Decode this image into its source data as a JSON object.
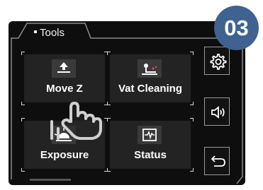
{
  "header": {
    "tab_title": "Tools"
  },
  "step_badge": {
    "text": "03",
    "color": "#3f6290"
  },
  "tiles": [
    {
      "label": "Move Z",
      "icon": "move-z-icon"
    },
    {
      "label": "Vat Cleaning",
      "icon": "vat-cleaning-icon"
    },
    {
      "label": "Exposure",
      "icon": "exposure-icon"
    },
    {
      "label": "Status",
      "icon": "status-icon"
    }
  ],
  "side_buttons": [
    {
      "icon": "gear-icon"
    },
    {
      "icon": "speaker-icon"
    },
    {
      "icon": "back-arrow-icon"
    }
  ],
  "overlay": {
    "icon": "tap-hand-icon"
  }
}
